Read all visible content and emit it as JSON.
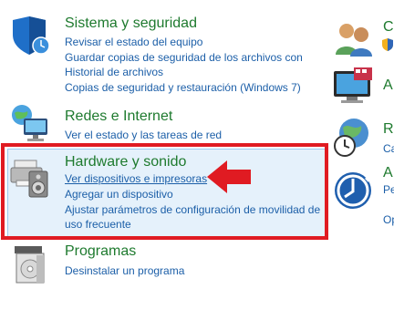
{
  "categories": {
    "system": {
      "title": "Sistema y seguridad",
      "links": [
        "Revisar el estado del equipo",
        "Guardar copias de seguridad de los archivos con",
        "Historial de archivos",
        "Copias de seguridad y restauración (Windows 7)"
      ]
    },
    "network": {
      "title": "Redes e Internet",
      "links": [
        "Ver el estado y las tareas de red"
      ]
    },
    "hardware": {
      "title": "Hardware y sonido",
      "links": [
        "Ver dispositivos e impresoras",
        "Agregar un dispositivo",
        "Ajustar parámetros de configuración de movilidad de",
        "uso frecuente"
      ]
    },
    "programs": {
      "title": "Programas",
      "links": [
        "Desinstalar un programa"
      ]
    }
  },
  "right_column": {
    "user_title_clip": "C",
    "appearance_title_clip": "A",
    "clock_title_clip": "R",
    "clock_link_clip": "Ca",
    "access_title_clip": "A",
    "access_links_clip": [
      "Pe",
      "Op"
    ]
  },
  "colors": {
    "title_green": "#1e7a2e",
    "link_blue": "#1c5fa8",
    "highlight_bg": "#e5f1fb",
    "annotation_red": "#e01b22"
  }
}
